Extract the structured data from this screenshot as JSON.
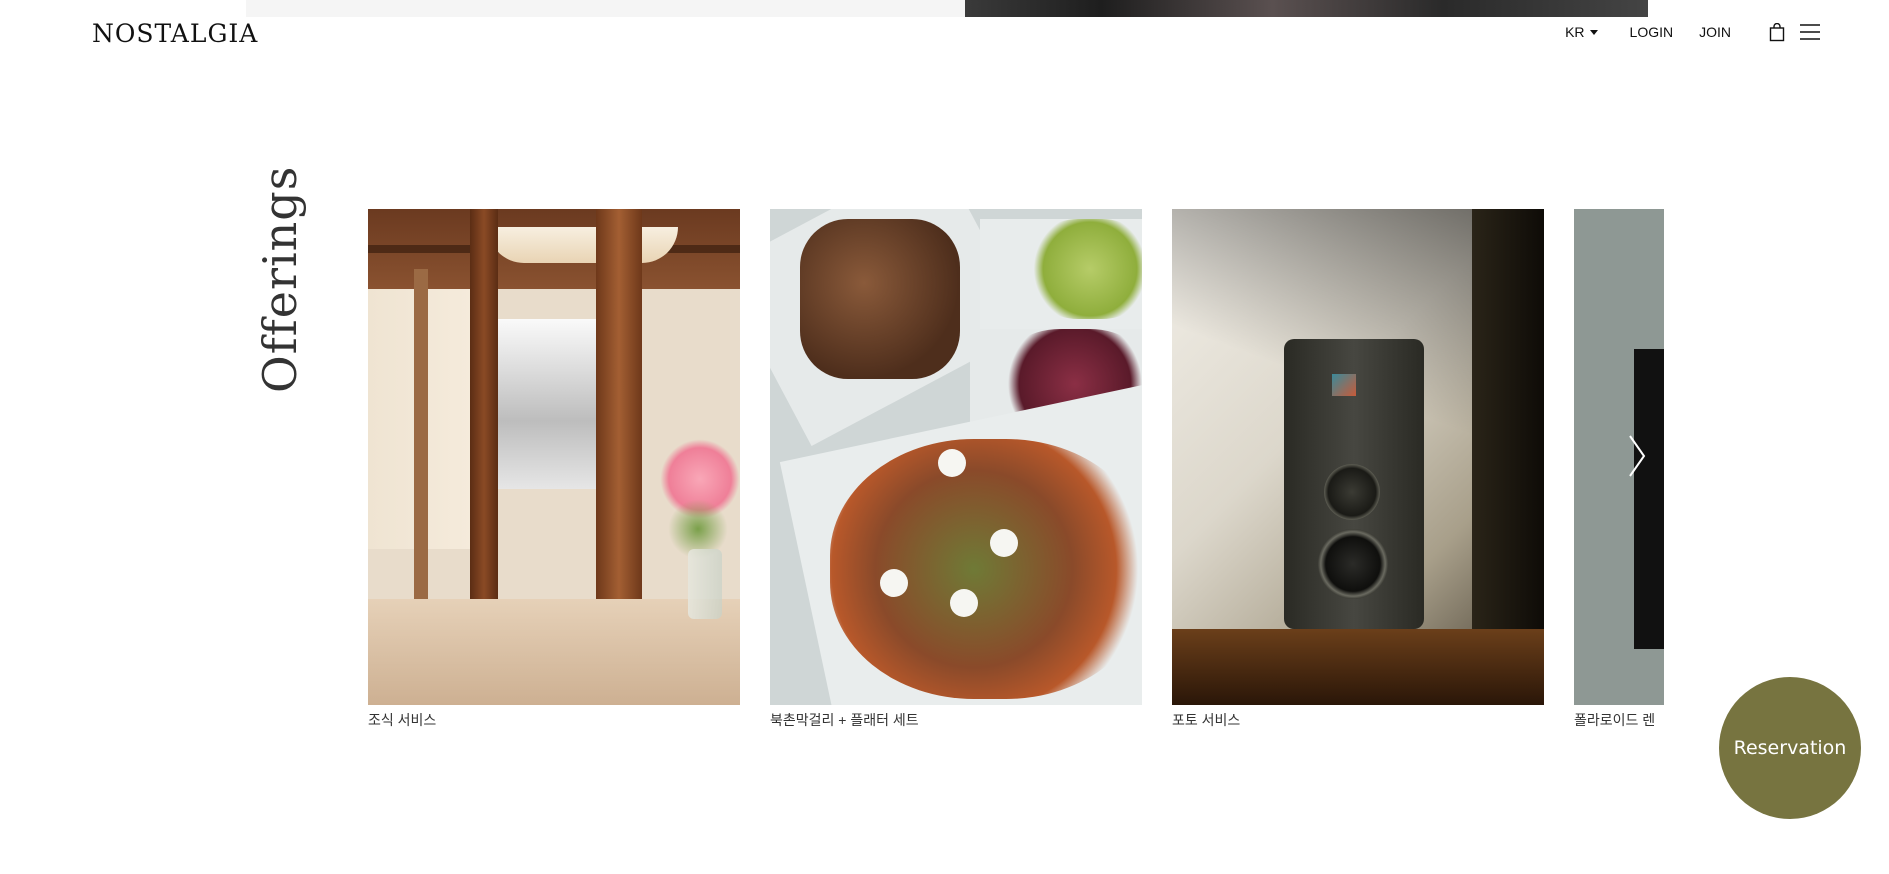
{
  "header": {
    "logo": "NOSTALGIA",
    "language": "KR",
    "login": "LOGIN",
    "join": "JOIN",
    "icons": [
      "shopping-bag-icon",
      "hamburger-menu-icon",
      "caret-down-icon"
    ]
  },
  "section": {
    "title": "Offerings"
  },
  "offerings": [
    {
      "caption": "조식 서비스"
    },
    {
      "caption": "북촌막걸리 + 플래터 세트"
    },
    {
      "caption": "포토 서비스"
    },
    {
      "caption": "폴라로이드 렌"
    }
  ],
  "carousel": {
    "next_icon": "chevron-right-icon"
  },
  "reservation": {
    "label": "Reservation",
    "color": "#777440"
  }
}
